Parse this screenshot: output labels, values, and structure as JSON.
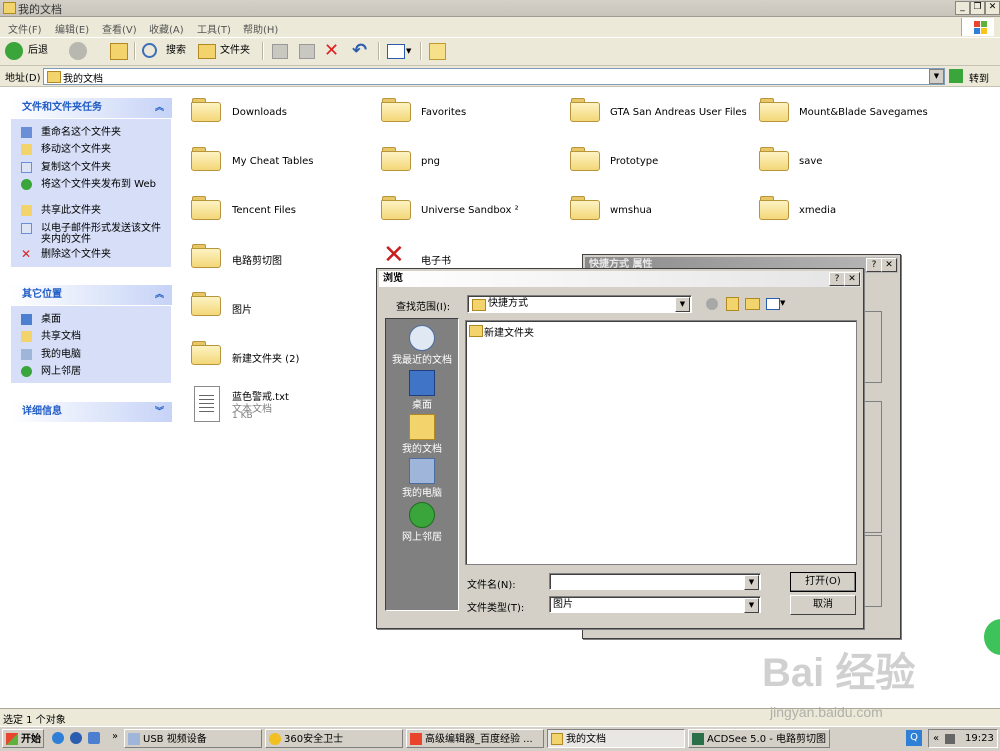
{
  "window": {
    "title": "我的文档"
  },
  "menu": [
    "文件(F)",
    "编辑(E)",
    "查看(V)",
    "收藏(A)",
    "工具(T)",
    "帮助(H)"
  ],
  "toolbar": {
    "back": "后退",
    "search": "搜索",
    "folders": "文件夹"
  },
  "address": {
    "label": "地址(D)",
    "value": "我的文档",
    "go": "转到"
  },
  "tasks_panel": {
    "title": "文件和文件夹任务",
    "items": [
      "重命名这个文件夹",
      "移动这个文件夹",
      "复制这个文件夹",
      "将这个文件夹发布到 Web",
      "共享此文件夹",
      "以电子邮件形式发送该文件夹内的文件",
      "删除这个文件夹"
    ]
  },
  "other_places": {
    "title": "其它位置",
    "items": [
      "桌面",
      "共享文档",
      "我的电脑",
      "网上邻居"
    ]
  },
  "details": {
    "title": "详细信息"
  },
  "files": {
    "folders": [
      "Downloads",
      "Favorites",
      "GTA San Andreas User Files",
      "Mount&Blade Savegames",
      "My Cheat Tables",
      "png",
      "Prototype",
      "save",
      "Tencent Files",
      "Universe Sandbox ²",
      "wmshua",
      "xmedia",
      "电路剪切图",
      "电子书",
      "图片",
      "新建文件夹 (2)"
    ],
    "txt": {
      "name": "蓝色警戒.txt",
      "type": "文本文档",
      "size": "1 KB"
    }
  },
  "behind_dialog": {
    "title": "快捷方式 属性"
  },
  "browse_dialog": {
    "title": "浏览",
    "look_in_label": "查找范围(I):",
    "look_in_value": "快捷方式",
    "places": [
      "我最近的文档",
      "桌面",
      "我的文档",
      "我的电脑",
      "网上邻居"
    ],
    "items": [
      "新建文件夹"
    ],
    "filename_label": "文件名(N):",
    "filename_value": "",
    "filetype_label": "文件类型(T):",
    "filetype_value": "图片",
    "open_button": "打开(O)",
    "cancel_button": "取消"
  },
  "statusbar": {
    "text": "选定 1 个对象"
  },
  "taskbar": {
    "start": "开始",
    "items": [
      "USB 视频设备",
      "360安全卫士",
      "高级编辑器_百度经验 ...",
      "我的文档",
      "ACDSee 5.0 - 电路剪切图"
    ],
    "clock": "19:23"
  },
  "watermark": {
    "text": "Bai 经验",
    "sub": "jingyan.baidu.com"
  }
}
